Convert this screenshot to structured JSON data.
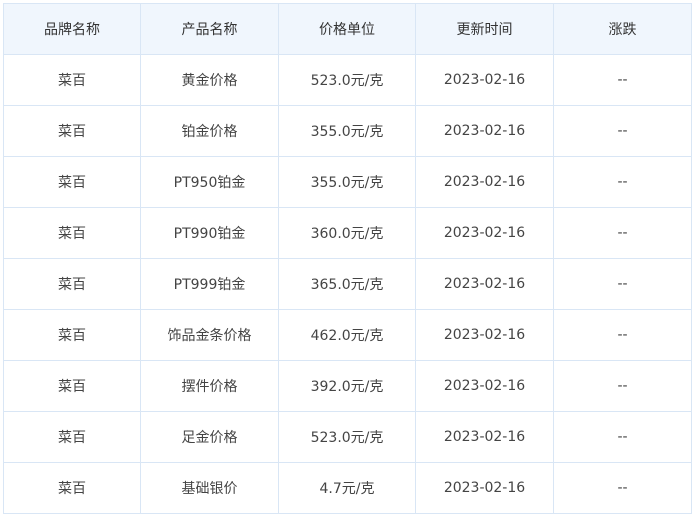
{
  "table": {
    "headers": [
      "品牌名称",
      "产品名称",
      "价格单位",
      "更新时间",
      "涨跌"
    ],
    "rows": [
      [
        "菜百",
        "黄金价格",
        "523.0元/克",
        "2023-02-16",
        "--"
      ],
      [
        "菜百",
        "铂金价格",
        "355.0元/克",
        "2023-02-16",
        "--"
      ],
      [
        "菜百",
        "PT950铂金",
        "355.0元/克",
        "2023-02-16",
        "--"
      ],
      [
        "菜百",
        "PT990铂金",
        "360.0元/克",
        "2023-02-16",
        "--"
      ],
      [
        "菜百",
        "PT999铂金",
        "365.0元/克",
        "2023-02-16",
        "--"
      ],
      [
        "菜百",
        "饰品金条价格",
        "462.0元/克",
        "2023-02-16",
        "--"
      ],
      [
        "菜百",
        "摆件价格",
        "392.0元/克",
        "2023-02-16",
        "--"
      ],
      [
        "菜百",
        "足金价格",
        "523.0元/克",
        "2023-02-16",
        "--"
      ],
      [
        "菜百",
        "基础银价",
        "4.7元/克",
        "2023-02-16",
        "--"
      ]
    ]
  },
  "colors": {
    "header_bg": "#f0f6fd",
    "border": "#d9e6f5",
    "text": "#444444"
  }
}
